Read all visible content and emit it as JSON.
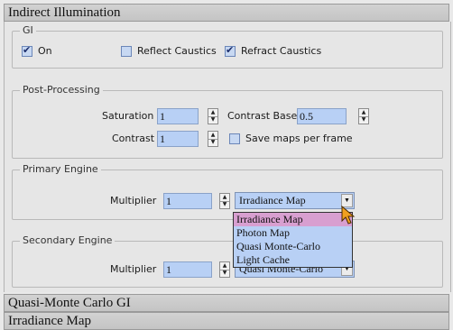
{
  "rollouts": {
    "indirect_illumination": "Indirect Illumination",
    "quasi_monte_carlo": "Quasi-Monte Carlo GI",
    "irradiance_map": "Irradiance Map"
  },
  "gi": {
    "legend": "GI",
    "on_label": "On",
    "on_checked": true,
    "reflect_caustics_label": "Reflect Caustics",
    "reflect_caustics_checked": false,
    "refract_caustics_label": "Refract Caustics",
    "refract_caustics_checked": true
  },
  "post_processing": {
    "legend": "Post-Processing",
    "saturation_label": "Saturation",
    "saturation_value": "1",
    "contrast_label": "Contrast",
    "contrast_value": "1",
    "contrast_base_label": "Contrast Base",
    "contrast_base_value": "0.5",
    "save_maps_label": "Save maps per frame",
    "save_maps_checked": false
  },
  "primary_engine": {
    "legend": "Primary Engine",
    "multiplier_label": "Multiplier",
    "multiplier_value": "1",
    "engine_value": "Irradiance Map"
  },
  "secondary_engine": {
    "legend": "Secondary Engine",
    "multiplier_label": "Multiplier",
    "multiplier_value": "1",
    "engine_value": "Quasi Monte-Carlo"
  },
  "engine_menu": {
    "options": [
      "Irradiance Map",
      "Photon Map",
      "Quasi Monte-Carlo",
      "Light Cache"
    ],
    "highlighted_index": 0
  },
  "icons": {
    "spinner_up": "▲",
    "spinner_down": "▼",
    "dropdown_arrow": "▼"
  },
  "colors": {
    "field_bg": "#b8d0f5",
    "menu_highlight": "#d89fd0",
    "header_bg": "#c8c8c8"
  }
}
